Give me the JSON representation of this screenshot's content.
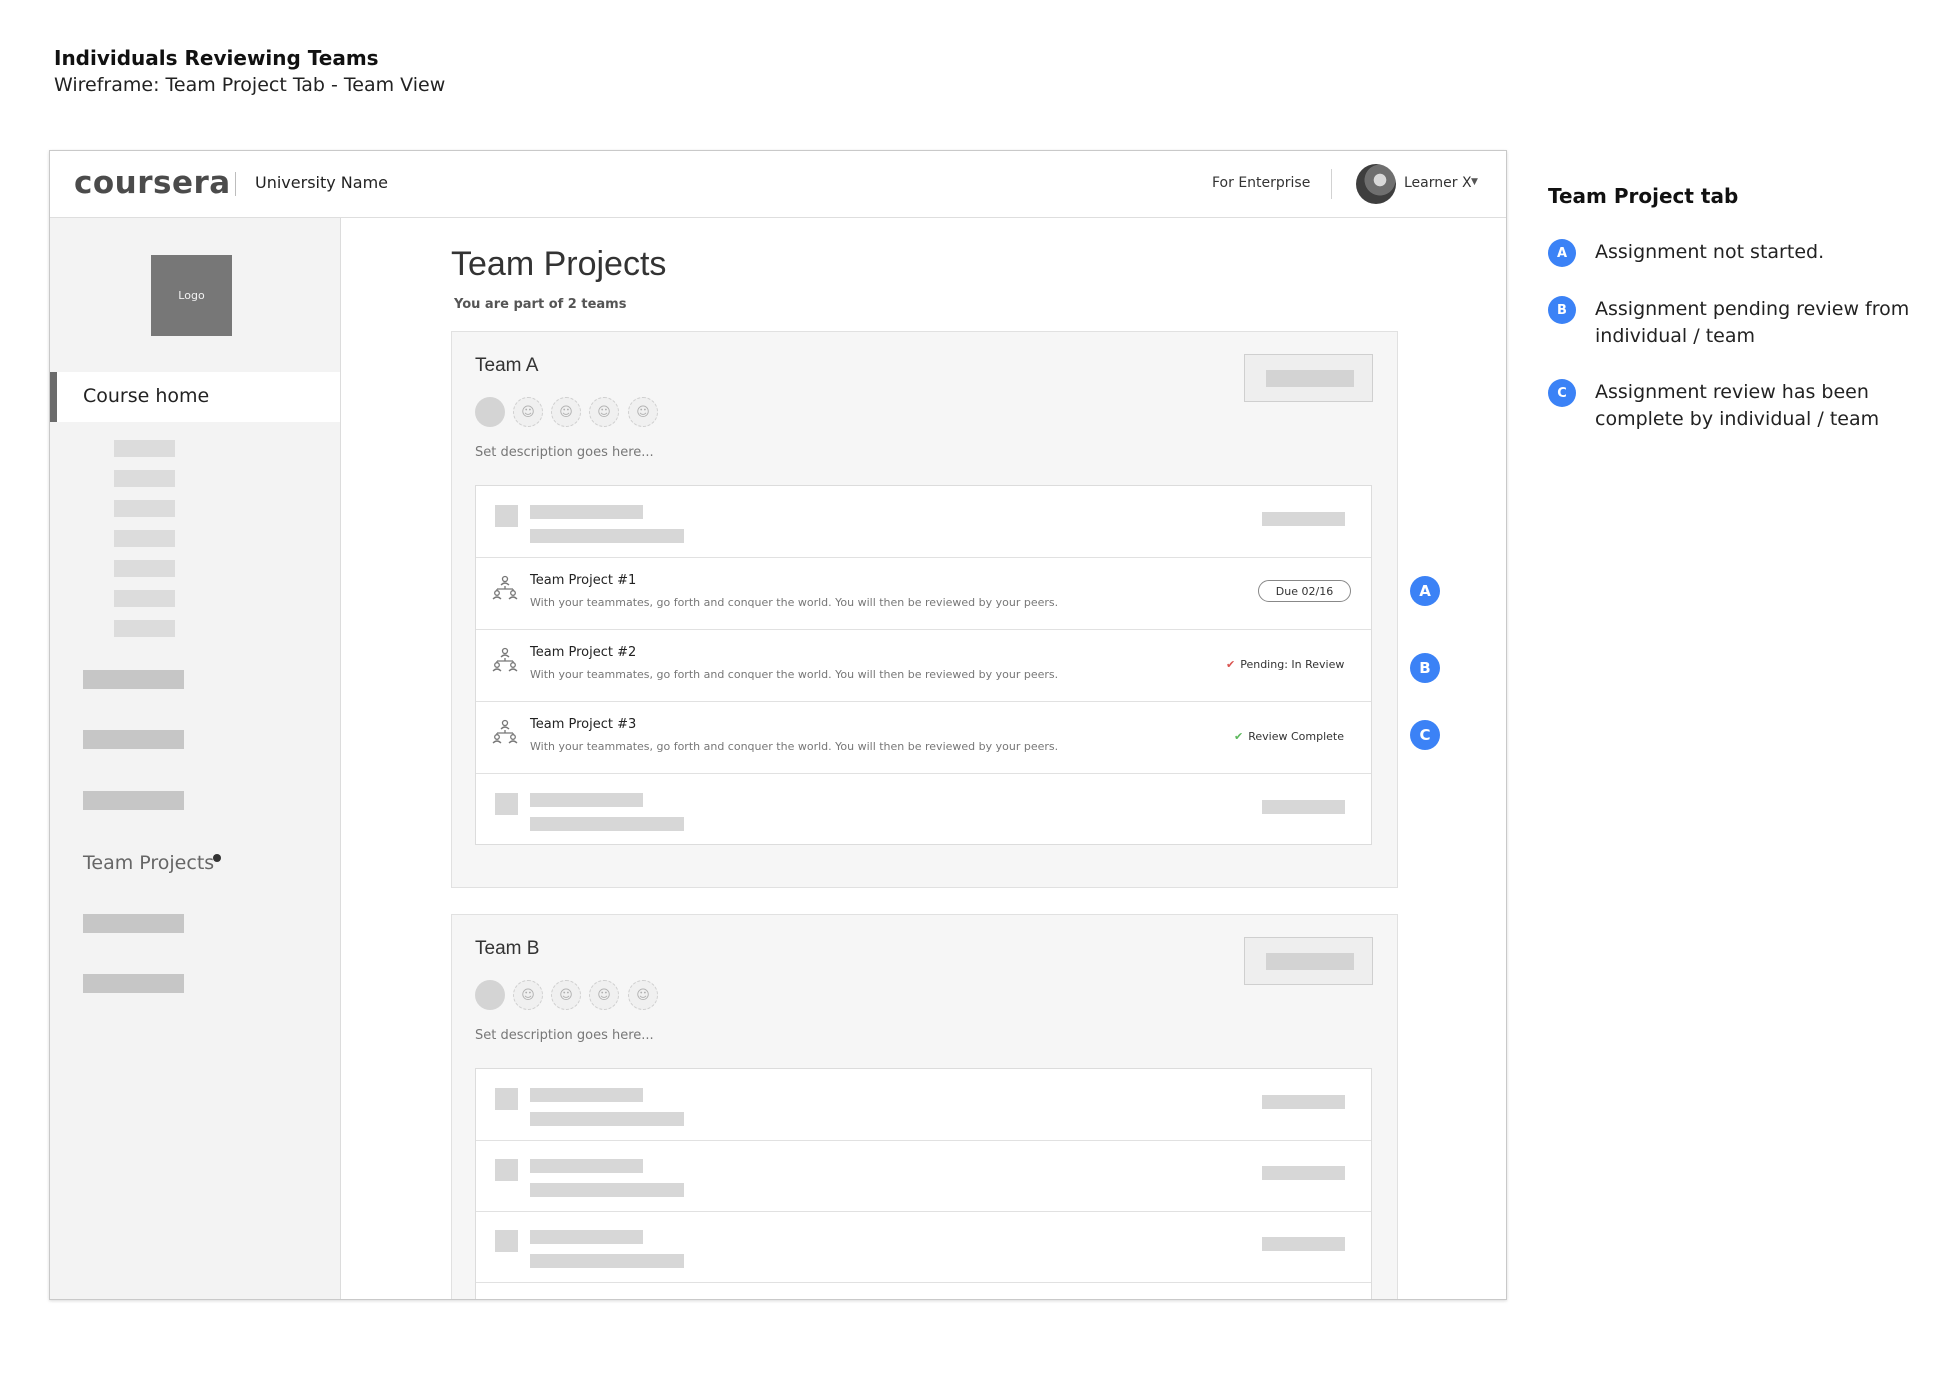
{
  "doc": {
    "title": "Individuals Reviewing Teams",
    "subtitle": "Wireframe: Team Project Tab - Team View"
  },
  "header": {
    "brand": "coursera",
    "university": "University Name",
    "for_enterprise": "For Enterprise",
    "user_name": "Learner X"
  },
  "sidebar": {
    "logo": "Logo",
    "course_home": "Course home",
    "team_projects": "Team Projects"
  },
  "main": {
    "title": "Team Projects",
    "teams_count": "You are part of 2 teams",
    "team_a": {
      "name": "Team A",
      "description": "Set description goes here...",
      "projects": [
        {
          "title": "Team Project #1",
          "description": "With your teammates, go forth and conquer the world.  You will then be reviewed by your peers.",
          "status": "Due 02/16"
        },
        {
          "title": "Team Project #2",
          "description": "With your teammates, go forth and conquer the world.  You will then be reviewed by your peers.",
          "status": "Pending: In Review",
          "status_color": "#d9534f"
        },
        {
          "title": "Team Project #3",
          "description": "With your teammates, go forth and conquer the world.  You will then be reviewed by your peers.",
          "status": "Review Complete",
          "status_color": "#5cb85c"
        }
      ]
    },
    "team_b": {
      "name": "Team B",
      "description": "Set description goes here..."
    }
  },
  "markers": [
    "A",
    "B",
    "C"
  ],
  "legend": {
    "title": "Team Project tab",
    "items": [
      {
        "badge": "A",
        "text": "Assignment not started."
      },
      {
        "badge": "B",
        "text": "Assignment pending review from individual / team"
      },
      {
        "badge": "C",
        "text": "Assignment review has been complete by individual / team"
      }
    ]
  },
  "colors": {
    "accent": "#3b82f6",
    "placeholder": "#d7d7d7",
    "sidebar_bg": "#f3f3f3"
  },
  "icons": {
    "team": "team-project-icon",
    "member": "user-icon",
    "caret": "caret-down-icon",
    "check": "check-icon"
  }
}
